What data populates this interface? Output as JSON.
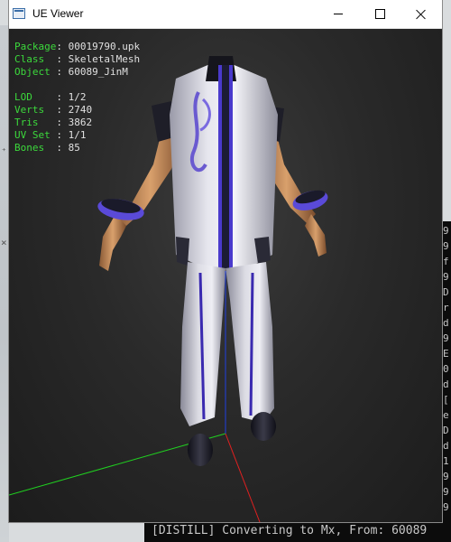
{
  "window": {
    "title": "UE Viewer"
  },
  "info": {
    "package": {
      "label": "Package",
      "value": "00019790.upk"
    },
    "class": {
      "label": "Class  ",
      "value": "SkeletalMesh"
    },
    "object": {
      "label": "Object ",
      "value": "60089_JinM"
    },
    "lod": {
      "label": "LOD    ",
      "value": "1/2"
    },
    "verts": {
      "label": "Verts  ",
      "value": "2740"
    },
    "tris": {
      "label": "Tris   ",
      "value": "3862"
    },
    "uvset": {
      "label": "UV Set ",
      "value": "1/1"
    },
    "bones": {
      "label": "Bones  ",
      "value": "85"
    }
  },
  "background_console": {
    "bottom_text": "[DISTILL] Converting to Mx, From: 60089",
    "side_chars": [
      "9",
      "9",
      "f",
      "9",
      "D",
      "r",
      "d",
      "9",
      "E",
      "0",
      "d",
      "[",
      "e",
      "D",
      "d",
      "1",
      "9",
      "9",
      "9"
    ]
  },
  "colors": {
    "axis_x": "#e02020",
    "axis_y": "#20d020",
    "axis_z": "#2040e0",
    "info_label": "#3cd93c",
    "info_value": "#e0e0e0"
  }
}
